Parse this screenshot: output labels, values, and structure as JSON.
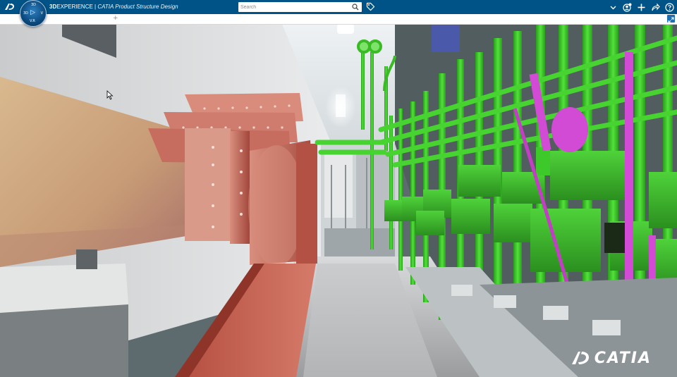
{
  "topbar": {
    "brand_bold": "3D",
    "brand_rest": "EXPERIENCE",
    "separator": " | ",
    "app_name": "CATIA Product Structure Design",
    "search_placeholder": "Search",
    "compass_labels": {
      "top": "3D",
      "left": "3D",
      "right": "V",
      "bottom": "V.R"
    }
  },
  "tabstrip": {
    "add_tab_label": "+"
  },
  "viewport": {
    "watermark_text": "CATIA"
  },
  "colors": {
    "topbar_bg": "#005386",
    "pipe_green": "#3fcf2a",
    "duct_copper": "#c8675a",
    "magenta": "#d24bd4"
  }
}
